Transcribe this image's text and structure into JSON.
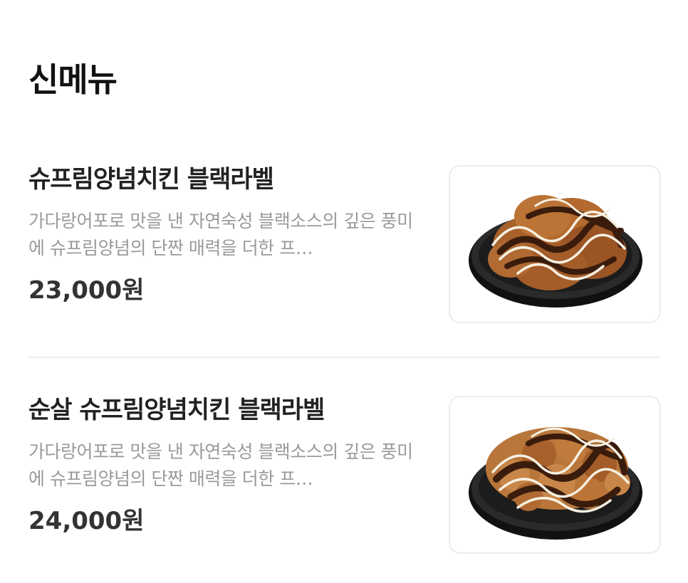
{
  "section": {
    "title": "신메뉴"
  },
  "items": [
    {
      "name": "슈프림양념치킨 블랙라벨",
      "description": "가다랑어포로 맛을 낸 자연숙성 블랙소스의 깊은 풍미에 슈프림양념의 단짠 매력을 더한 프…",
      "price": "23,000원",
      "image_icon": "chicken-dish-image"
    },
    {
      "name": "순살 슈프림양념치킨 블랙라벨",
      "description": "가다랑어포로 맛을 낸 자연숙성 블랙소스의 깊은 풍미에 슈프림양념의 단짠 매력을 더한 프…",
      "price": "24,000원",
      "image_icon": "boneless-chicken-dish-image"
    }
  ],
  "colors": {
    "title": "#111111",
    "name": "#222222",
    "description": "#9a9a9a",
    "price": "#333333",
    "divider": "#ededed",
    "plate": "#1c1c1c",
    "chicken": "#a8612a",
    "sauce": "#3a1c0c",
    "mayo": "#f6f0e2"
  }
}
